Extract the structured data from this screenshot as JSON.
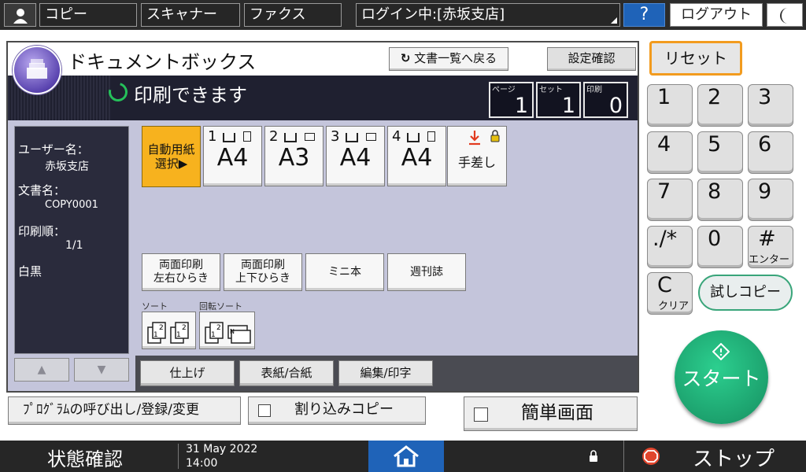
{
  "topbar": {
    "tabs": [
      "コピー",
      "スキャナー",
      "ファクス"
    ],
    "login": "ログイン中:[赤坂支店]",
    "help": "?",
    "logout": "ログアウト"
  },
  "header": {
    "title": "ドキュメントボックス",
    "back_button": "文書一覧へ戻る",
    "settings_button": "設定確認",
    "status": "印刷できます",
    "counters": [
      {
        "label": "ページ",
        "value": "1"
      },
      {
        "label": "セット",
        "value": "1"
      },
      {
        "label": "印刷",
        "value": "0"
      }
    ]
  },
  "info": {
    "user_label": "ユーザー名：",
    "user_value": "赤坂支店",
    "doc_label": "文書名：",
    "doc_value": "COPY0001",
    "order_label": "印刷順：",
    "order_value": "1/1",
    "color": "白黒"
  },
  "paper": {
    "auto_select_line1": "自動用紙",
    "auto_select_line2": "選択▶",
    "trays": [
      {
        "num": "1",
        "size": "A4"
      },
      {
        "num": "2",
        "size": "A3"
      },
      {
        "num": "3",
        "size": "A4"
      },
      {
        "num": "4",
        "size": "A4"
      }
    ],
    "bypass": "手差し"
  },
  "binding": {
    "lr_line1": "両面印刷",
    "lr_line2": "左右ひらき",
    "tb_line1": "両面印刷",
    "tb_line2": "上下ひらき",
    "mini": "ミニ本",
    "weekly": "週刊誌"
  },
  "sort": {
    "sort_label": "ソート",
    "rotate_label": "回転ソート"
  },
  "tabs": [
    "仕上げ",
    "表紙/合紙",
    "編集/印字"
  ],
  "keypad": {
    "reset": "リセット",
    "keys": [
      "1",
      "2",
      "3",
      "4",
      "5",
      "6",
      "7",
      "8",
      "9",
      "./*",
      "0",
      "#"
    ],
    "enter": "エンター",
    "clear_key": "C",
    "clear": "クリア",
    "trial": "試しコピー",
    "start": "スタート"
  },
  "lower": {
    "program": "ﾌﾟﾛｸﾞﾗﾑの呼び出し/登録/変更",
    "interrupt": "割り込みコピー",
    "simple": "簡単画面"
  },
  "bottombar": {
    "state": "状態確認",
    "date": "31 May 2022",
    "time": "14:00",
    "stop": "ストップ"
  },
  "colors": {
    "accent": "#f7b21e",
    "start": "#1a9b69",
    "help": "#1f63b8",
    "reset_border": "#f29b1e"
  }
}
